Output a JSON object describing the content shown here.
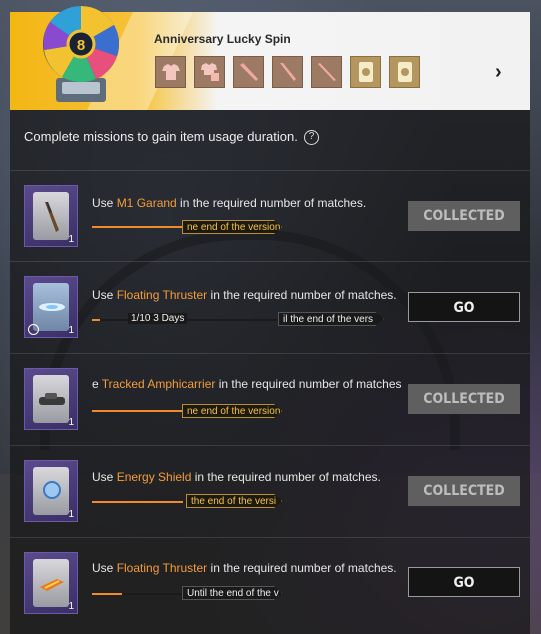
{
  "header": {
    "title": "Anniversary Lucky Spin",
    "rewards": [
      {
        "icon": "outfit-top-icon",
        "color": "#9c7a63"
      },
      {
        "icon": "outfit-set-icon",
        "color": "#9c7a63"
      },
      {
        "icon": "weapon-skin-icon",
        "color": "#9c7a63"
      },
      {
        "icon": "weapon-skin-icon",
        "color": "#9c7a63"
      },
      {
        "icon": "weapon-skin-icon",
        "color": "#9c7a63"
      },
      {
        "icon": "voucher-card-icon",
        "color": "#b39660"
      },
      {
        "icon": "voucher-card-icon",
        "color": "#b39660"
      }
    ],
    "next_icon": "chevron-right-icon"
  },
  "intro": "Complete missions to gain item usage duration.",
  "missions": [
    {
      "prefix": "Use ",
      "item": "M1 Garand",
      "suffix": " in the required number of matches.",
      "tag": "ne end of the version",
      "button": "COLLECTED",
      "count": "1",
      "progress": 0.48
    },
    {
      "prefix": "Use ",
      "item": "Floating Thruster",
      "suffix": " in the required number of matches.",
      "progress_text": "1/10  3 Days",
      "tag": "il the end of the vers",
      "button": "GO",
      "count": "1",
      "progress": 0.04
    },
    {
      "prefix": "e ",
      "item": "Tracked Amphicarrier",
      "suffix": " in the required number of matches",
      "tag": "ne end of the version",
      "button": "COLLECTED",
      "count": "1",
      "progress": 0.48
    },
    {
      "prefix": "Use ",
      "item": "Energy Shield",
      "suffix": " in the required number of matches.",
      "tag": "the end of the versi",
      "button": "COLLECTED",
      "count": "1",
      "progress": 0.48
    },
    {
      "prefix": "Use ",
      "item": "Floating Thruster",
      "suffix": " in the required number of matches.",
      "tag": "Until the end of the v",
      "button": "GO",
      "count": "1",
      "progress": 0.16
    }
  ],
  "colors": {
    "accent_orange": "#f39c3a",
    "tag_gold": "#f5c542",
    "header_yellow": "#f3b614",
    "card_purple": "#5a4a8c"
  }
}
